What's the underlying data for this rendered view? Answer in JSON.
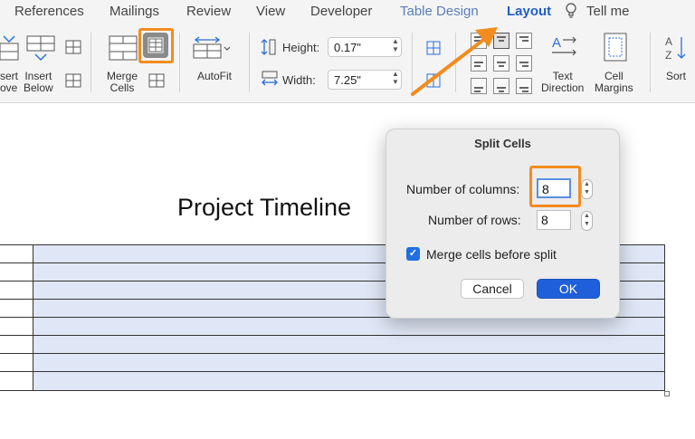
{
  "ribbon_tabs": {
    "references": "References",
    "mailings": "Mailings",
    "review": "Review",
    "view": "View",
    "developer": "Developer",
    "table_design": "Table Design",
    "layout": "Layout",
    "tell_me": "Tell me"
  },
  "ribbon": {
    "insert_above_1": "sert",
    "insert_above_2": "ove",
    "insert_below_1": "Insert",
    "insert_below_2": "Below",
    "merge_cells_1": "Merge",
    "merge_cells_2": "Cells",
    "autofit": "AutoFit",
    "height_label": "Height:",
    "height_value": "0.17\"",
    "width_label": "Width:",
    "width_value": "7.25\"",
    "text_direction_1": "Text",
    "text_direction_2": "Direction",
    "cell_margins_1": "Cell",
    "cell_margins_2": "Margins",
    "sort": "Sort"
  },
  "document": {
    "title": "Project Timeline",
    "table_rows": 8
  },
  "dialog": {
    "title": "Split Cells",
    "columns_label": "Number of columns:",
    "columns_value": "8",
    "rows_label": "Number of rows:",
    "rows_value": "8",
    "merge_label": "Merge cells before split",
    "merge_checked": true,
    "cancel_label": "Cancel",
    "ok_label": "OK"
  },
  "colors": {
    "highlight": "#f28c1e",
    "accent": "#1f5fd9",
    "table_shade": "#dfe6f5"
  }
}
